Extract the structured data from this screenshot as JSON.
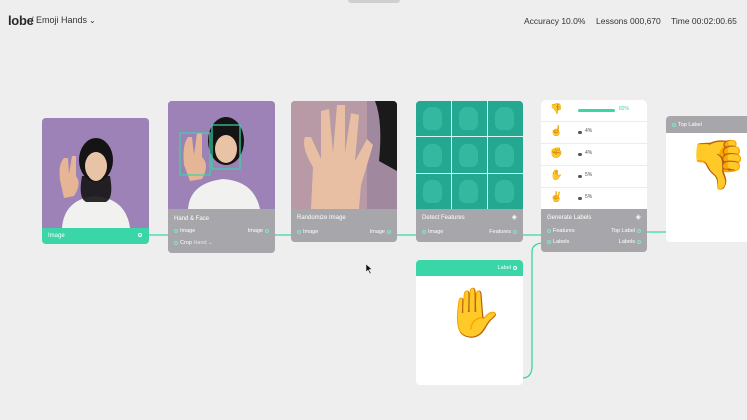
{
  "app": {
    "logo": "lobe",
    "project": "/ Emoji Hands",
    "chevron": "⌄"
  },
  "stats": {
    "accuracy": "Accuracy 10.0%",
    "lessons": "Lessons 000,670",
    "time": "Time 00:02:00.65"
  },
  "nodes": {
    "image": {
      "title": "Image"
    },
    "hand_face": {
      "title": "Hand & Face",
      "in": "Image",
      "out": "Image",
      "crop_label": "Crop",
      "crop_value": "Hand ⌄"
    },
    "randomize": {
      "title": "Randomize Image",
      "in": "Image",
      "out": "Image"
    },
    "features": {
      "title": "Detect Features",
      "in": "Image",
      "out": "Features"
    },
    "generate": {
      "title": "Generate Labels",
      "in1": "Features",
      "in2": "Labels",
      "out1": "Top Label",
      "out2": "Labels",
      "rows": [
        {
          "icon": "thumbs-down-icon",
          "glyph": "👎",
          "pct": "82%",
          "value": 0.82
        },
        {
          "icon": "point-up-icon",
          "glyph": "☝",
          "pct": "4%",
          "value": 0.04
        },
        {
          "icon": "fist-icon",
          "glyph": "✊",
          "pct": "4%",
          "value": 0.04
        },
        {
          "icon": "open-hand-icon",
          "glyph": "✋",
          "pct": "5%",
          "value": 0.05
        },
        {
          "icon": "victory-icon",
          "glyph": "✌",
          "pct": "5%",
          "value": 0.05
        }
      ]
    },
    "top_label": {
      "title": "Top Label",
      "emoji": "👎"
    },
    "label": {
      "title": "Label",
      "emoji": "✋"
    }
  },
  "colors": {
    "accent": "#3ad6a7",
    "card_foot": "#a7a7ab",
    "background": "#eeeeee"
  }
}
